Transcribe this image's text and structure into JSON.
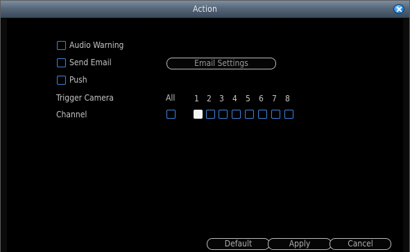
{
  "window": {
    "title": "Action"
  },
  "options": {
    "audio_warning": "Audio Warning",
    "send_email": "Send Email",
    "push": "Push"
  },
  "email_settings_button": "Email Settings",
  "trigger": {
    "label": "Trigger Camera",
    "all_label": "All",
    "channels": [
      "1",
      "2",
      "3",
      "4",
      "5",
      "6",
      "7",
      "8"
    ]
  },
  "channel_row": {
    "label": "Channel",
    "all_checked": false,
    "checked": [
      true,
      false,
      false,
      false,
      false,
      false,
      false,
      false
    ]
  },
  "footer": {
    "default": "Default",
    "apply": "Apply",
    "cancel": "Cancel"
  },
  "colors": {
    "checkbox_border": "#3e86e0",
    "checked_fill": "#f4f4f4",
    "titlebar": "#56677a"
  }
}
